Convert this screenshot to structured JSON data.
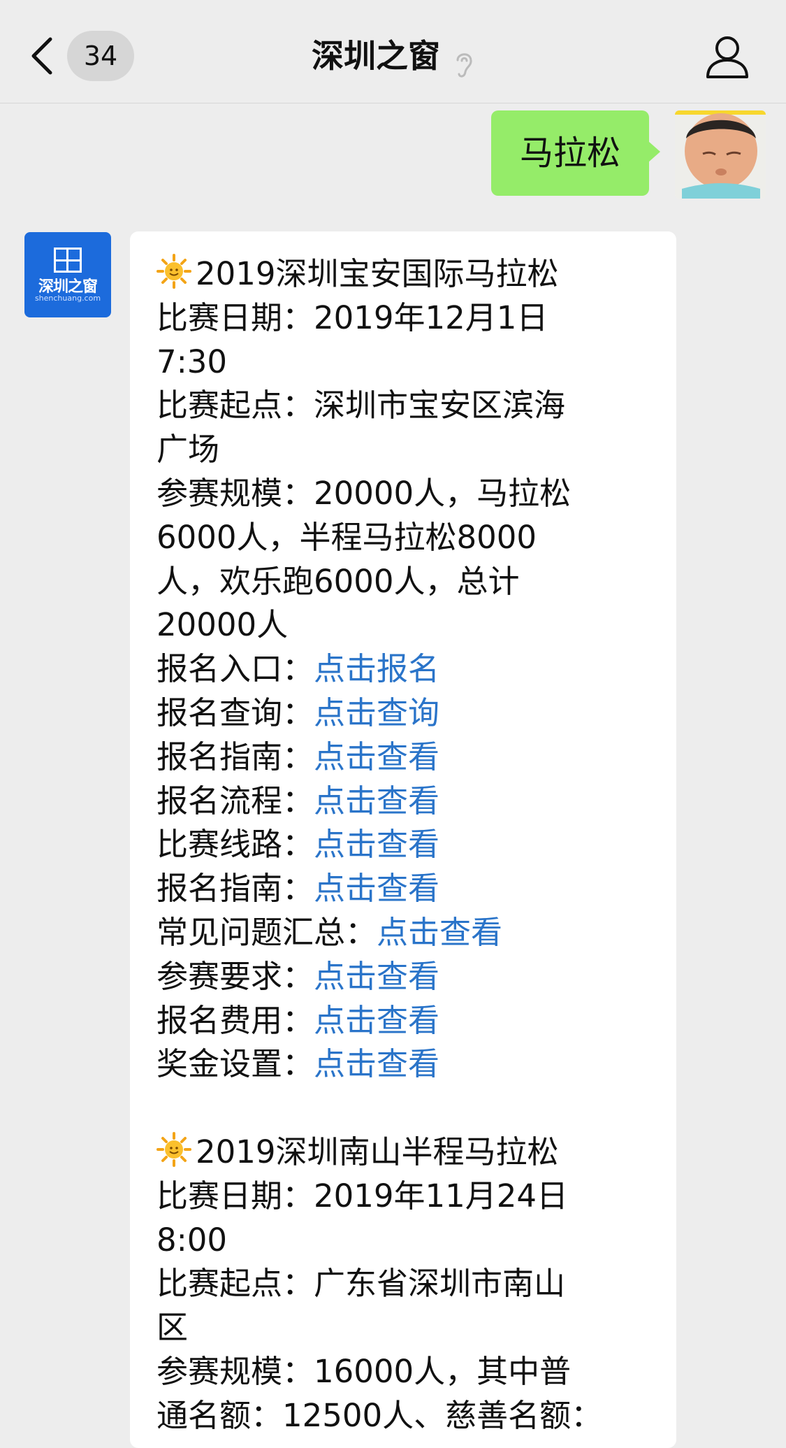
{
  "header": {
    "unread_count": "34",
    "title": "深圳之窗"
  },
  "user_message": {
    "text": "马拉松"
  },
  "bot_logo": {
    "name": "深圳之窗",
    "domain": "shenchuang.com"
  },
  "bot_message": {
    "lines": [
      {
        "label": "2019深圳宝安国际马拉松",
        "link": "",
        "sun": true
      },
      {
        "label": "比赛日期：2019年12月1日",
        "link": ""
      },
      {
        "label": "7:30",
        "link": ""
      },
      {
        "label": "比赛起点：深圳市宝安区滨海",
        "link": ""
      },
      {
        "label": "广场",
        "link": ""
      },
      {
        "label": "参赛规模：20000人，马拉松",
        "link": ""
      },
      {
        "label": "6000人，半程马拉松8000",
        "link": ""
      },
      {
        "label": "人，欢乐跑6000人，总计",
        "link": ""
      },
      {
        "label": "20000人",
        "link": ""
      },
      {
        "label": "报名入口：",
        "link": "点击报名"
      },
      {
        "label": "报名查询：",
        "link": "点击查询"
      },
      {
        "label": "报名指南：",
        "link": "点击查看"
      },
      {
        "label": "报名流程：",
        "link": "点击查看"
      },
      {
        "label": "比赛线路：",
        "link": "点击查看"
      },
      {
        "label": "报名指南：",
        "link": "点击查看"
      },
      {
        "label": "常见问题汇总：",
        "link": "点击查看"
      },
      {
        "label": "参赛要求：",
        "link": "点击查看"
      },
      {
        "label": "报名费用：",
        "link": "点击查看"
      },
      {
        "label": "奖金设置：",
        "link": "点击查看"
      },
      {
        "label": "",
        "link": ""
      },
      {
        "label": "2019深圳南山半程马拉松",
        "link": "",
        "sun": true
      },
      {
        "label": "比赛日期：2019年11月24日",
        "link": ""
      },
      {
        "label": "8:00",
        "link": ""
      },
      {
        "label": "比赛起点：广东省深圳市南山",
        "link": ""
      },
      {
        "label": "区",
        "link": ""
      },
      {
        "label": "参赛规模：16000人，其中普",
        "link": ""
      },
      {
        "label": "通名额：12500人、慈善名额：",
        "link": ""
      }
    ]
  },
  "colors": {
    "link": "#2a74c9",
    "user_bubble": "#95ec69",
    "background": "#ededed"
  }
}
